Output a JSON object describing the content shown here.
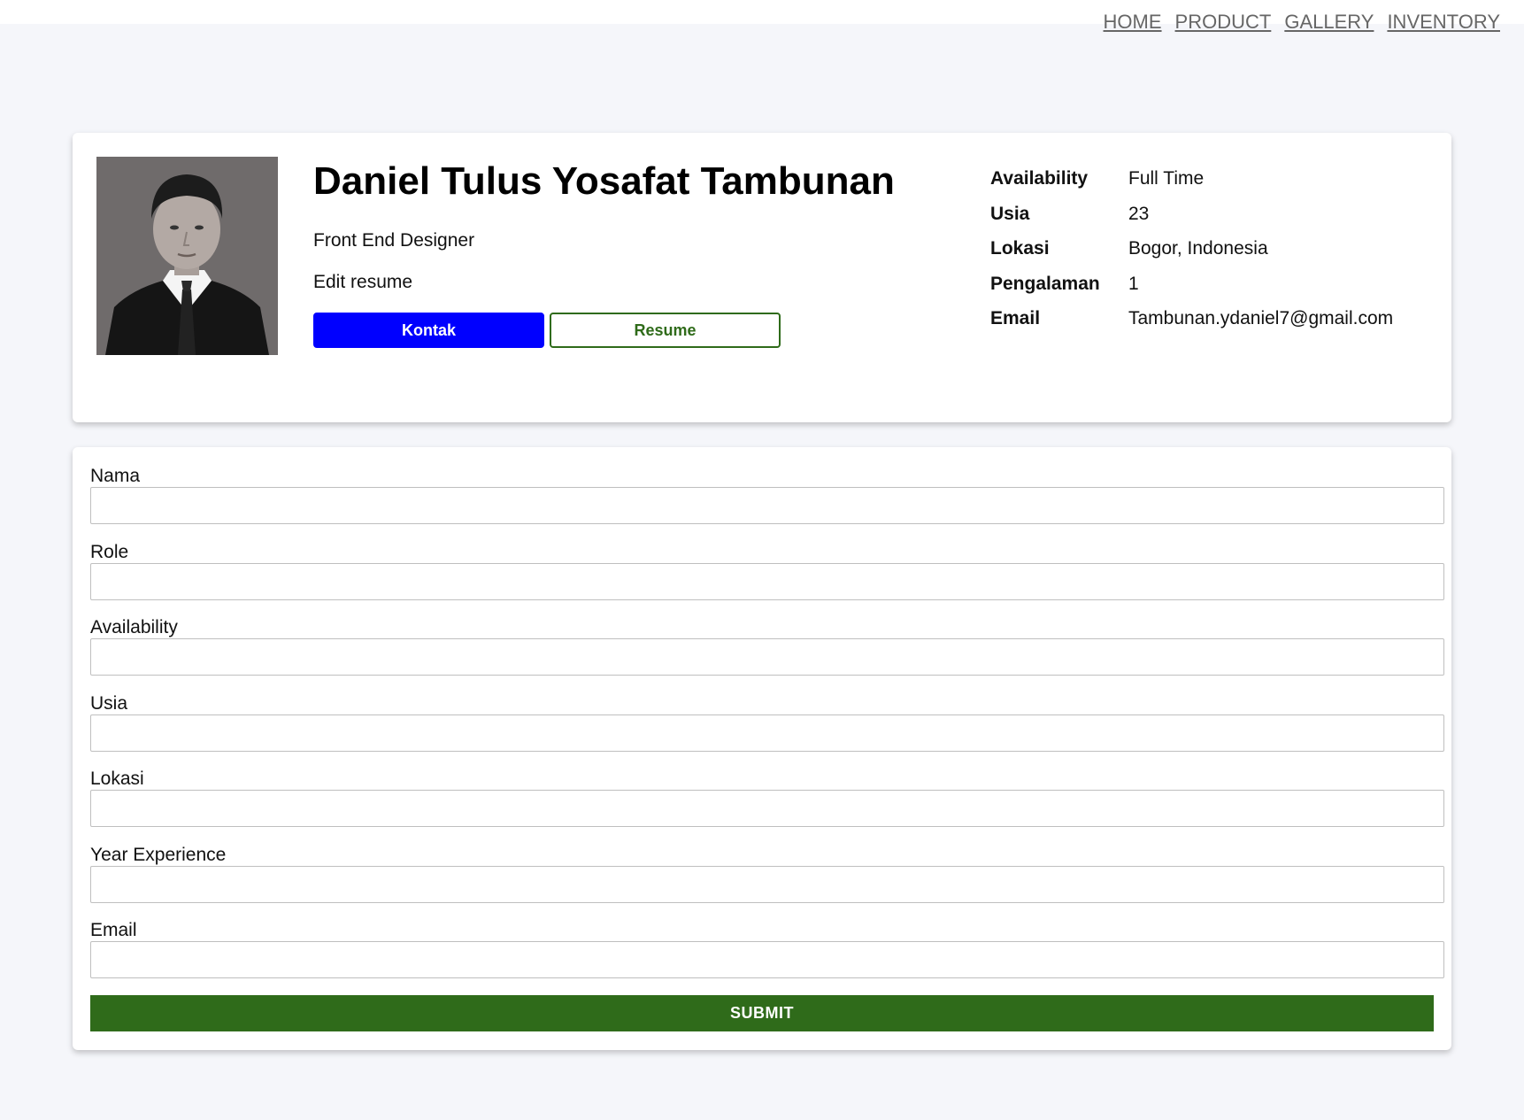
{
  "nav": {
    "links": [
      "HOME",
      "PRODUCT",
      "GALLERY",
      "INVENTORY"
    ]
  },
  "profile": {
    "name": "Daniel Tulus Yosafat Tambunan",
    "role": "Front End Designer",
    "edit_label": "Edit resume",
    "contact_button": "Kontak",
    "resume_button": "Resume",
    "info": [
      {
        "label": "Availability",
        "value": "Full Time"
      },
      {
        "label": "Usia",
        "value": "23"
      },
      {
        "label": "Lokasi",
        "value": "Bogor, Indonesia"
      },
      {
        "label": "Pengalaman",
        "value": "1"
      },
      {
        "label": "Email",
        "value": "Tambunan.ydaniel7@gmail.com"
      }
    ]
  },
  "form": {
    "fields": [
      {
        "label": "Nama",
        "value": ""
      },
      {
        "label": "Role",
        "value": ""
      },
      {
        "label": "Availability",
        "value": ""
      },
      {
        "label": "Usia",
        "value": ""
      },
      {
        "label": "Lokasi",
        "value": ""
      },
      {
        "label": "Year Experience",
        "value": ""
      },
      {
        "label": "Email",
        "value": ""
      }
    ],
    "submit_label": "SUBMIT"
  },
  "colors": {
    "contact_button": "#0000ff",
    "resume_accent": "#2f6b1a",
    "submit_button": "#2f6b1a",
    "page_background": "#f5f6fa"
  }
}
